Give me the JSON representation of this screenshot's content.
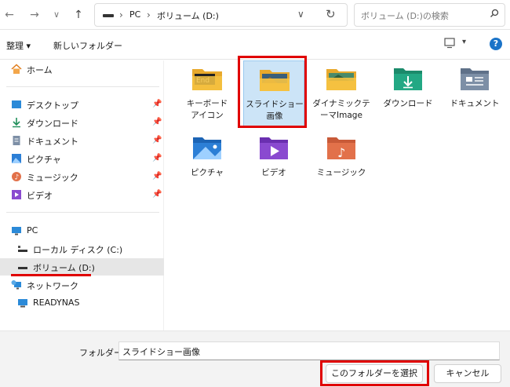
{
  "address": {
    "crumbs": [
      "PC",
      "ボリューム (D:)"
    ]
  },
  "search": {
    "placeholder": "ボリューム (D:)の検索"
  },
  "toolbar": {
    "organize_label": "整理 ▾",
    "new_folder_label": "新しいフォルダー",
    "help_label": "?"
  },
  "sidebar": {
    "home": "ホーム",
    "quick": [
      "デスクトップ",
      "ダウンロード",
      "ドキュメント",
      "ピクチャ",
      "ミュージック",
      "ビデオ"
    ],
    "pc": "PC",
    "drives": [
      "ローカル ディスク (C:)",
      "ボリューム (D:)"
    ],
    "network": "ネットワーク",
    "network_items": [
      "READYNAS"
    ]
  },
  "items": [
    {
      "name1": "キーボード",
      "name2": "アイコン",
      "icon": "folder-keyboard-icon"
    },
    {
      "name1": "スライドショー",
      "name2": "画像",
      "icon": "folder-slideshow-icon"
    },
    {
      "name1": "ダイナミックテ",
      "name2": "ーマImage",
      "icon": "folder-landscape-icon"
    },
    {
      "name1": "ダウンロード",
      "name2": "",
      "icon": "downloads-folder-icon"
    },
    {
      "name1": "ドキュメント",
      "name2": "",
      "icon": "documents-folder-icon"
    },
    {
      "name1": "ピクチャ",
      "name2": "",
      "icon": "pictures-folder-icon"
    },
    {
      "name1": "ビデオ",
      "name2": "",
      "icon": "videos-folder-icon"
    },
    {
      "name1": "ミュージック",
      "name2": "",
      "icon": "music-folder-icon"
    }
  ],
  "footer": {
    "folder_label": "フォルダー:",
    "folder_value": "スライドショー画像",
    "select_button": "このフォルダーを選択",
    "cancel_button": "キャンセル"
  },
  "colors": {
    "accent": "#1a73c8",
    "highlight_red": "#e00000",
    "selection": "#cce4f7",
    "folder_yellow": "#f6c342"
  }
}
